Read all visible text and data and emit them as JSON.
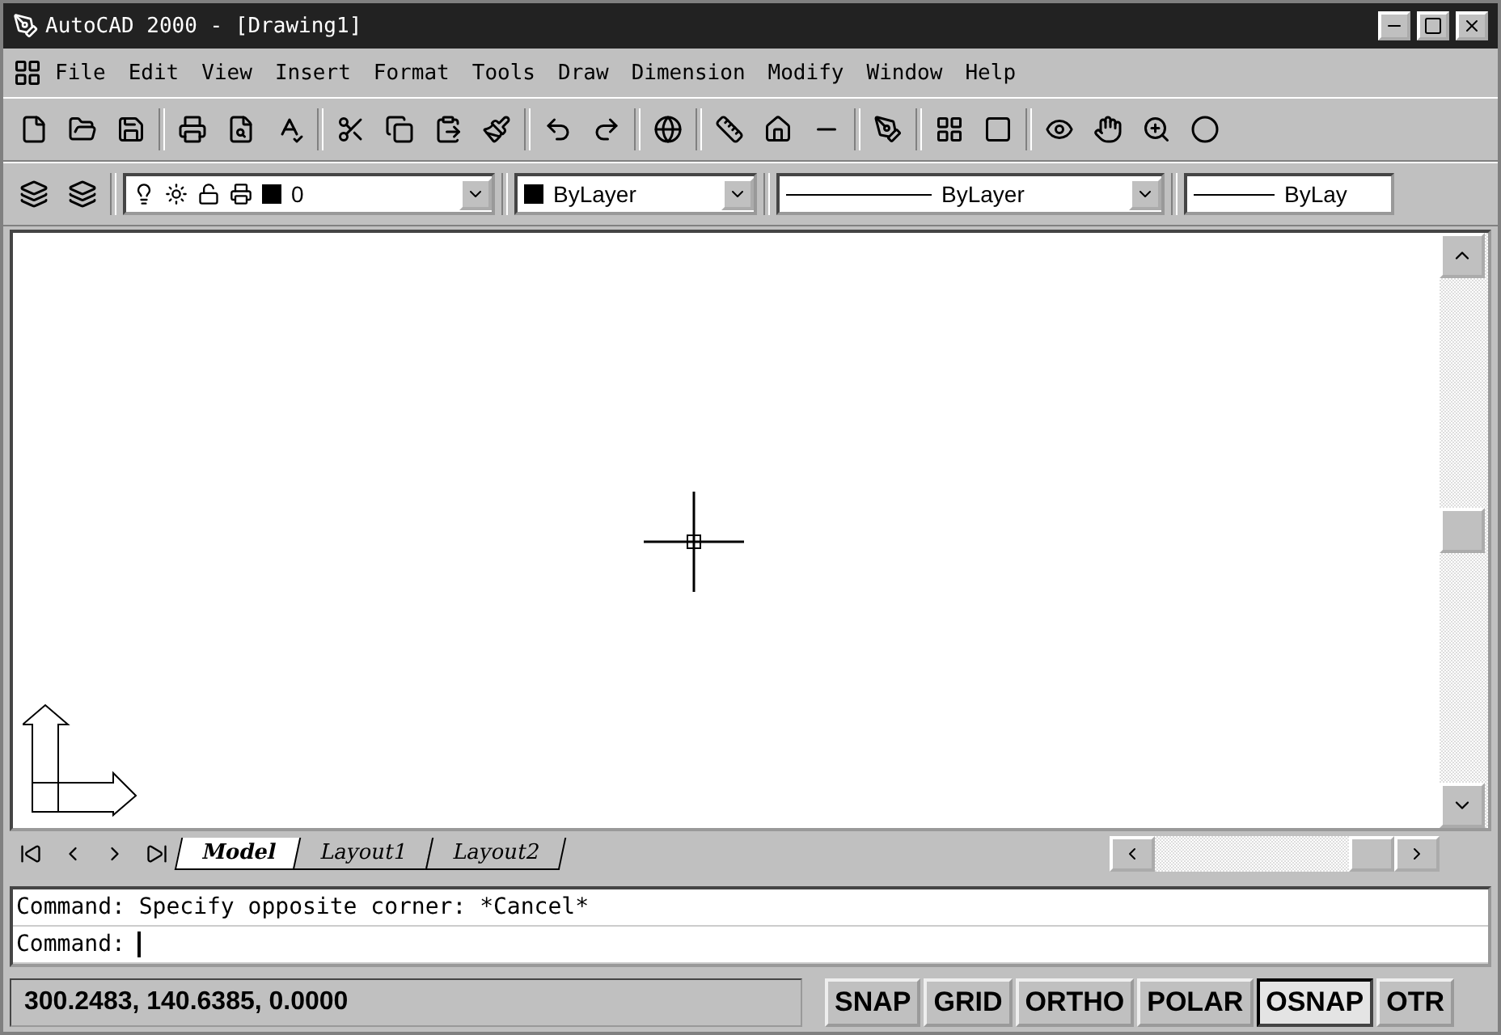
{
  "window": {
    "title": "AutoCAD 2000 - [Drawing1]"
  },
  "menu": [
    "File",
    "Edit",
    "View",
    "Insert",
    "Format",
    "Tools",
    "Draw",
    "Dimension",
    "Modify",
    "Window",
    "Help"
  ],
  "properties_bar": {
    "layer": "0",
    "color_setting": "ByLayer",
    "linetype": "ByLayer",
    "lineweight": "ByLay"
  },
  "layout_tabs": [
    {
      "label": "Model",
      "selected": true
    },
    {
      "label": "Layout1",
      "selected": false
    },
    {
      "label": "Layout2",
      "selected": false
    }
  ],
  "command_history": [
    "Command: Specify opposite corner: *Cancel*"
  ],
  "command_prompt": "Command:",
  "status_bar": {
    "coordinates": "300.2483, 140.6385, 0.0000",
    "toggles": [
      {
        "label": "SNAP",
        "selected": false
      },
      {
        "label": "GRID",
        "selected": false
      },
      {
        "label": "ORTHO",
        "selected": false
      },
      {
        "label": "POLAR",
        "selected": false
      },
      {
        "label": "OSNAP",
        "selected": true
      },
      {
        "label": "OTR",
        "selected": false
      }
    ]
  }
}
